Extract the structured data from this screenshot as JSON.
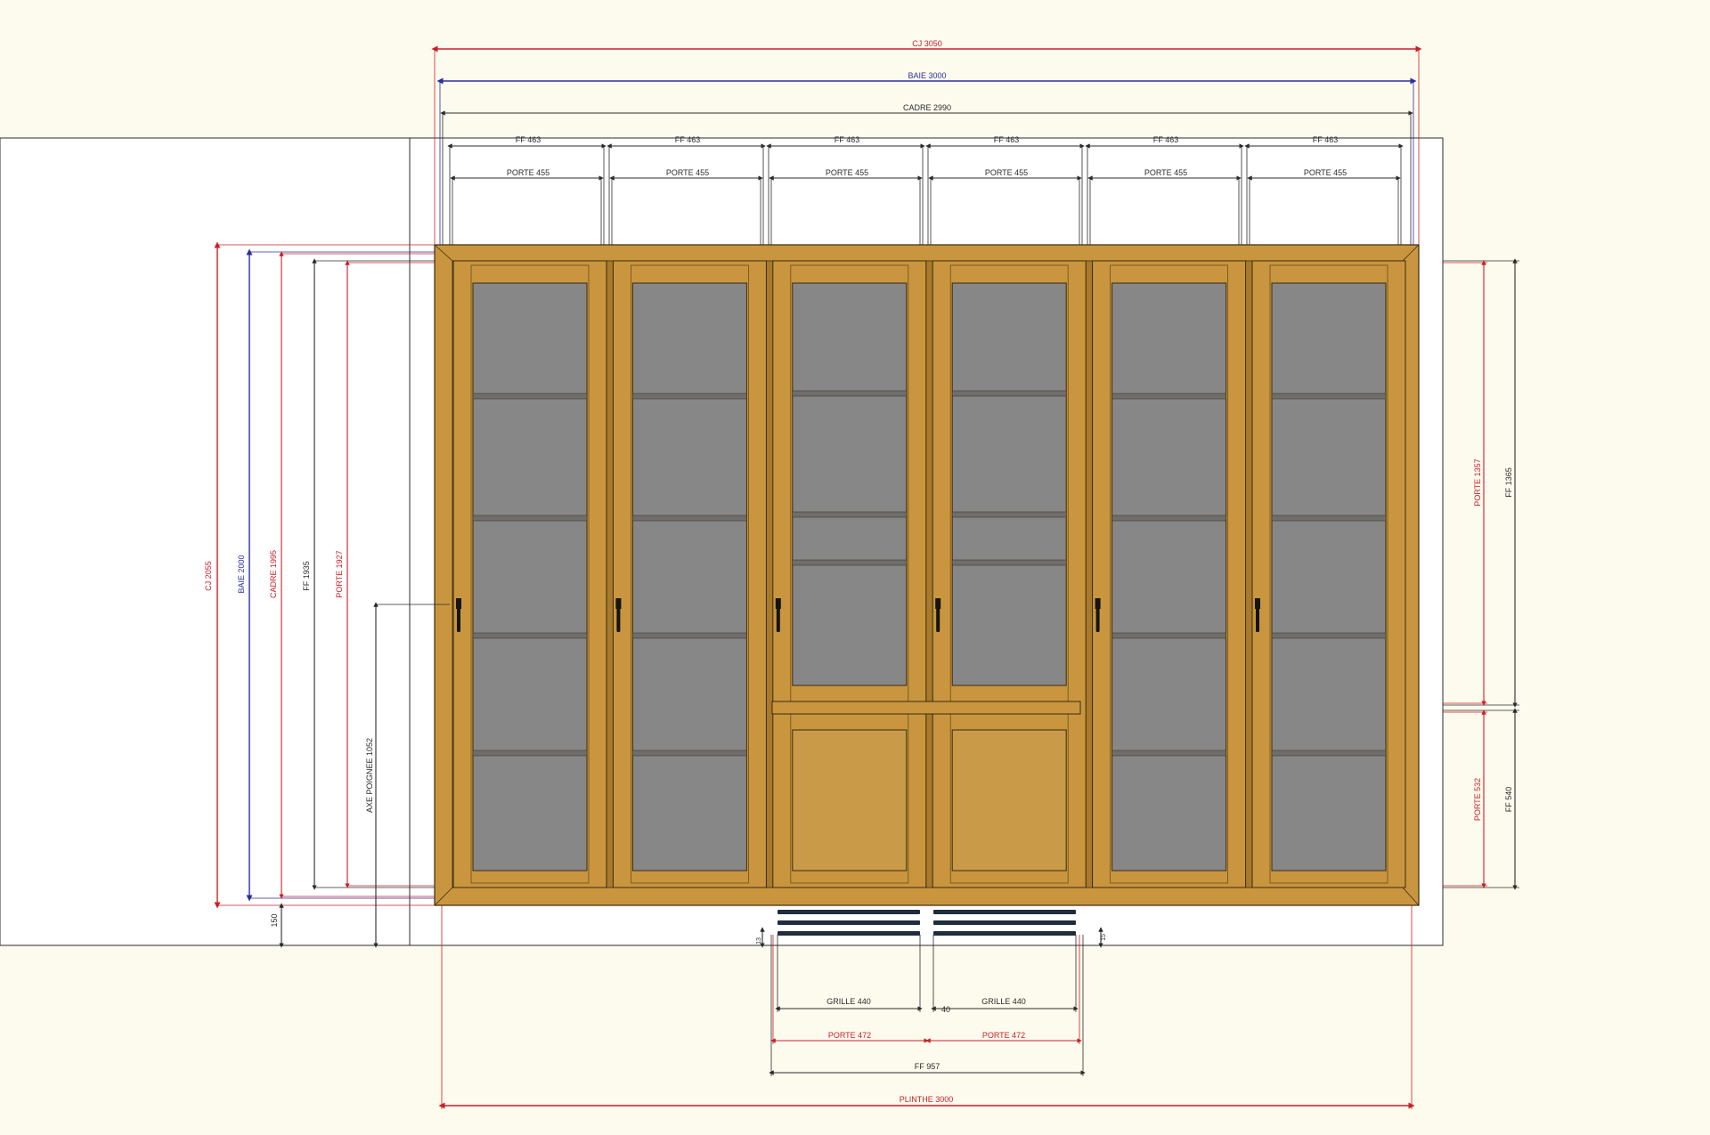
{
  "colors": {
    "background": "#fdfbee",
    "wall": "#ffffff",
    "wood": "#c9963f",
    "wood_dark": "#a87a2c",
    "glass": "#878787",
    "dim_red": "#c8202a",
    "dim_blue": "#2a2f9e",
    "dim_black": "#2b2b2b",
    "grille": "#1f2d3d",
    "handle": "#141414"
  },
  "top_dims": {
    "cj": "CJ 3050",
    "baie": "BAIE 3000",
    "cadre": "CADRE 2990",
    "ff_leaves": [
      "FF 463",
      "FF 463",
      "FF 463",
      "FF 463",
      "FF 463",
      "FF 463"
    ],
    "porte_leaves": [
      "PORTE 455",
      "PORTE 455",
      "PORTE 455",
      "PORTE 455",
      "PORTE 455",
      "PORTE 455"
    ]
  },
  "left_dims": {
    "cj": "CJ 2055",
    "baie": "BAIE 2000",
    "cadre": "CADRE 1995",
    "ff": "FF 1935",
    "porte": "PORTE 1927",
    "axe": "AXE POIGNEE 1052",
    "offset": "150"
  },
  "right_dims": {
    "porte_upper": "PORTE 1357",
    "ff_upper": "FF 1365",
    "porte_lower": "PORTE 532",
    "ff_lower": "FF 540"
  },
  "bottom_dims": {
    "grille_left": "GRILLE 440",
    "grille_right": "GRILLE 440",
    "grille_gap": "40",
    "porte_left": "PORTE 472",
    "porte_right": "PORTE 472",
    "ff": "FF 957",
    "plinthe": "PLINTHE 3000",
    "small_left": "13",
    "small_right": "15"
  }
}
